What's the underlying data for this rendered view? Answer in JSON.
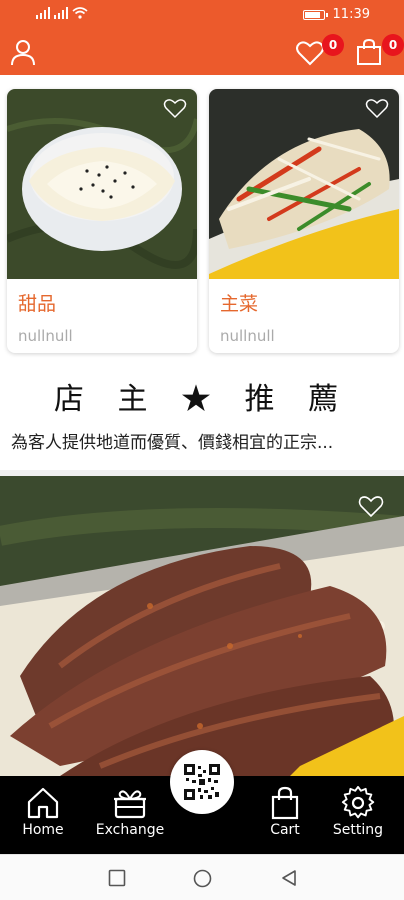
{
  "status_bar": {
    "time": "11:39"
  },
  "header": {
    "wishlist_count": "0",
    "cart_count": "0"
  },
  "products": [
    {
      "name": "甜品",
      "price": "nullnull"
    },
    {
      "name": "主菜",
      "price": "nullnull"
    }
  ],
  "recommend": {
    "title": "店 主 ★ 推 薦",
    "description": "為客人提供地道而優質、價錢相宜的正宗..."
  },
  "tabs": {
    "home": "Home",
    "exchange": "Exchange",
    "cart": "Cart",
    "setting": "Setting"
  },
  "colors": {
    "accent": "#ec5a2c",
    "badge": "#e8141d",
    "product_name": "#e5682e"
  }
}
